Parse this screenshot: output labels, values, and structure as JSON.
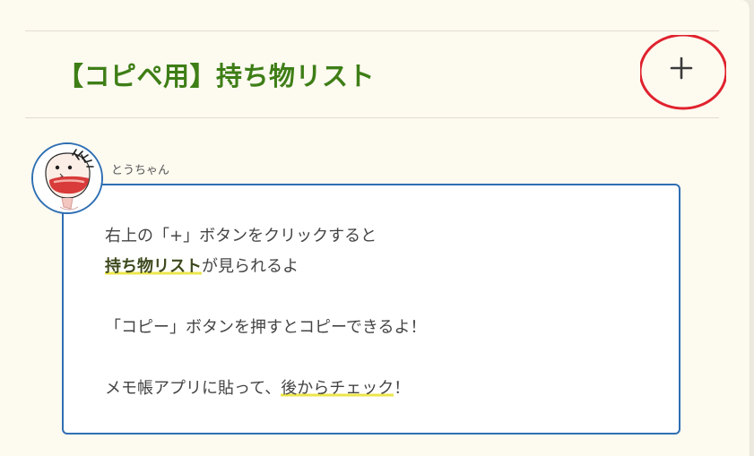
{
  "accordion": {
    "title": "【コピペ用】持ち物リスト",
    "toggle_icon": "plus-icon"
  },
  "speech": {
    "speaker_name": "とうちゃん",
    "avatar_icon": "drawn-face-avatar",
    "line1": "右上の「+」ボタンをクリックすると",
    "line2_highlight": "持ち物リスト",
    "line2_rest": "が見られるよ",
    "line3": "「コピー」ボタンを押すとコピーできるよ！",
    "line4_before": "メモ帳アプリに貼って、",
    "line4_highlight": "後からチェック",
    "line4_after": "！"
  },
  "colors": {
    "title_green": "#3e7e16",
    "bubble_border_blue": "#2f6fb3",
    "highlight_yellow": "#ece64c",
    "annotation_red": "#e0222e",
    "page_background": "#fdfaf0"
  }
}
